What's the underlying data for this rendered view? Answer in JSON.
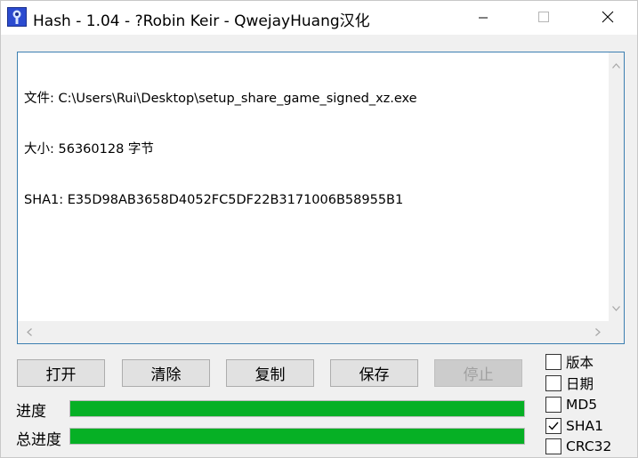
{
  "window": {
    "title": "Hash - 1.04 - ?Robin Keir - QwejayHuang汉化",
    "icon": "keyhole-icon",
    "minimize_icon": "minimize-icon",
    "maximize_icon": "maximize-icon",
    "close_icon": "close-icon"
  },
  "output": {
    "lines": [
      "文件: C:\\Users\\Rui\\Desktop\\setup_share_game_signed_xz.exe",
      "大小: 56360128 字节",
      "SHA1: E35D98AB3658D4052FC5DF22B3171006B58955B1"
    ]
  },
  "buttons": {
    "open": "打开",
    "clear": "清除",
    "copy": "复制",
    "save": "保存",
    "stop": "停止"
  },
  "progress": {
    "label": "进度",
    "total_label": "总进度",
    "value": 1.0,
    "total_value": 1.0,
    "color": "#06b025"
  },
  "options": [
    {
      "label": "版本",
      "checked": false
    },
    {
      "label": "日期",
      "checked": false
    },
    {
      "label": "MD5",
      "checked": false
    },
    {
      "label": "SHA1",
      "checked": true
    },
    {
      "label": "CRC32",
      "checked": false
    }
  ]
}
